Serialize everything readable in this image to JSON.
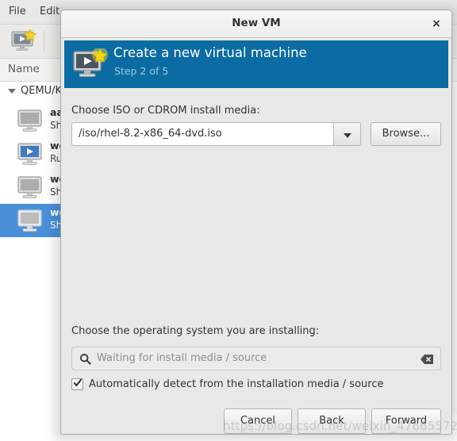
{
  "background_window": {
    "menubar": {
      "items": [
        {
          "label": "File"
        },
        {
          "label": "Edit"
        }
      ]
    },
    "toolbar": {
      "new_vm_icon": "new-vm-monitor-star-icon"
    },
    "column_header": {
      "name": "Name"
    },
    "tree": {
      "group_label": "QEMU/KV",
      "rows": [
        {
          "name": "aa",
          "state": "Sh",
          "icon": "monitor-icon",
          "selected": false
        },
        {
          "name": "we",
          "state": "Ru",
          "icon": "monitor-running-icon",
          "selected": false
        },
        {
          "name": "we",
          "state": "Sh",
          "icon": "monitor-icon",
          "selected": false
        },
        {
          "name": "we",
          "state": "Sh",
          "icon": "monitor-icon",
          "selected": true
        }
      ]
    }
  },
  "dialog": {
    "title": "New VM",
    "close_label": "×",
    "banner": {
      "title": "Create a new virtual machine",
      "step": "Step 2 of 5",
      "icon": "new-vm-monitor-star-icon",
      "bg_color": "#0b6ba3"
    },
    "iso": {
      "label": "Choose ISO or CDROM install media:",
      "value": "/iso/rhel-8.2-x86_64-dvd.iso",
      "browse_label": "Browse..."
    },
    "os": {
      "label": "Choose the operating system you are installing:",
      "search_placeholder": "Waiting for install media / source",
      "search_value": "",
      "search_icon": "search-icon",
      "clear_icon": "clear-entry-icon",
      "autodetect_label": "Automatically detect from the installation media / source",
      "autodetect_checked": true
    },
    "buttons": {
      "cancel": "Cancel",
      "back": "Back",
      "forward": "Forward"
    }
  },
  "watermark": {
    "text": "https://blog.csdn.net/weixin_47665572"
  },
  "colors": {
    "banner_blue": "#0b6ba3",
    "selection_blue": "#4a90d9",
    "dialog_bg": "#e8e8e6"
  }
}
